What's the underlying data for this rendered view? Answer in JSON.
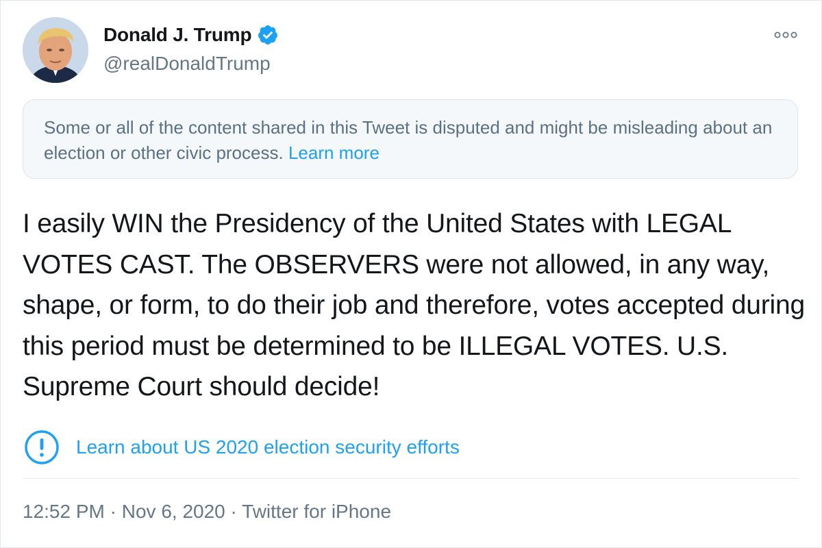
{
  "author": {
    "name": "Donald J. Trump",
    "handle": "@realDonaldTrump",
    "verified": true
  },
  "notice": {
    "text": "Some or all of the content shared in this Tweet is disputed and might be misleading about an election or other civic process.",
    "link_label": "Learn more"
  },
  "tweet_text": "I easily WIN the Presidency of the United States with LEGAL VOTES CAST. The OBSERVERS were not allowed, in any way, shape, or form, to do their job and therefore, votes accepted during this period must be determined to be ILLEGAL VOTES. U.S. Supreme Court should decide!",
  "election_link": {
    "icon": "exclamation-circle-icon",
    "label": "Learn about US 2020 election security efforts"
  },
  "meta": {
    "time": "12:52 PM",
    "date": "Nov 6, 2020",
    "source": "Twitter for iPhone",
    "separator": "·"
  },
  "colors": {
    "accent": "#1da1f2",
    "text": "#14171a",
    "muted": "#657786",
    "notice_bg": "#f5f8fa"
  },
  "icons": {
    "more": "more-options-icon",
    "verified": "verified-badge-icon"
  }
}
